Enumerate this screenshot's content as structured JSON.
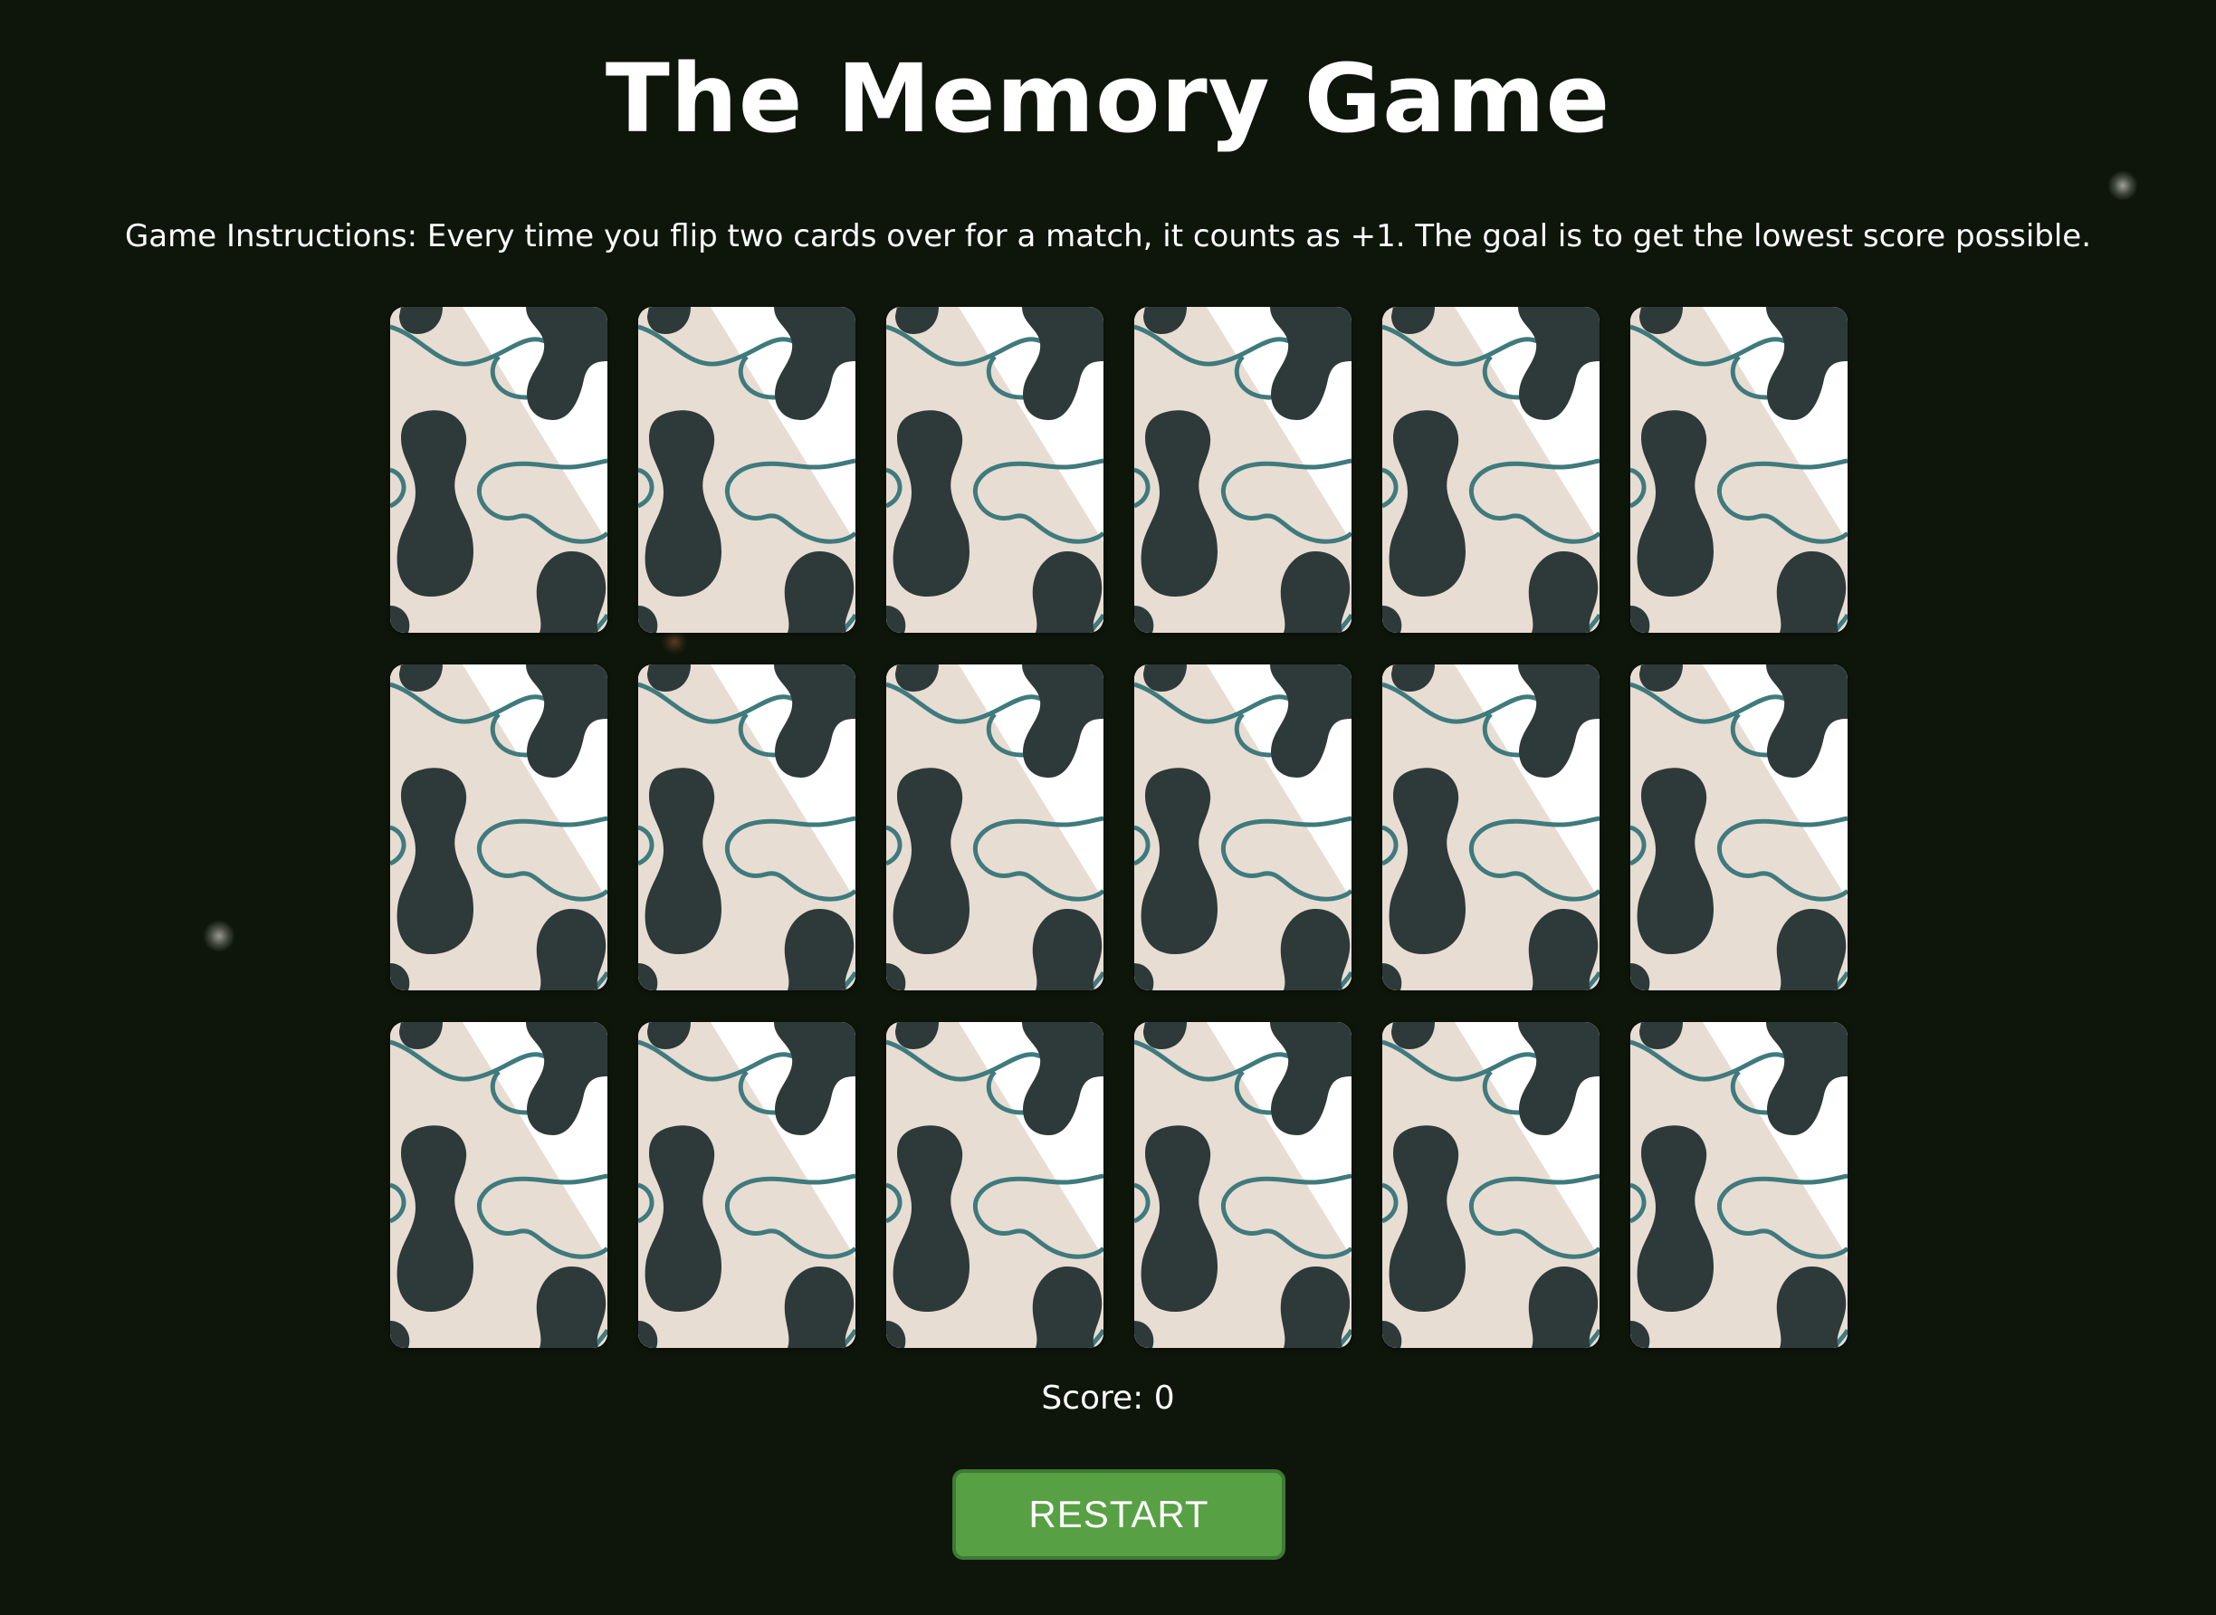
{
  "title": "The Memory Game",
  "instructions": "Game Instructions: Every time you flip two cards over for a match, it counts as +1. The goal is to get the lowest score possible.",
  "board": {
    "rows": 3,
    "columns": 6,
    "cards": [
      {
        "state": "face-down"
      },
      {
        "state": "face-down"
      },
      {
        "state": "face-down"
      },
      {
        "state": "face-down"
      },
      {
        "state": "face-down"
      },
      {
        "state": "face-down"
      },
      {
        "state": "face-down"
      },
      {
        "state": "face-down"
      },
      {
        "state": "face-down"
      },
      {
        "state": "face-down"
      },
      {
        "state": "face-down"
      },
      {
        "state": "face-down"
      },
      {
        "state": "face-down"
      },
      {
        "state": "face-down"
      },
      {
        "state": "face-down"
      },
      {
        "state": "face-down"
      },
      {
        "state": "face-down"
      },
      {
        "state": "face-down"
      }
    ]
  },
  "score": {
    "label": "Score:",
    "value": 0,
    "text": "Score: 0"
  },
  "restart_label": "RESTART",
  "colors": {
    "background": "#0e160b",
    "card_dark": "#2e3a39",
    "card_light": "#ffffff",
    "card_beige": "#e8ddd3",
    "card_line": "#3f7a7d",
    "button": "#58a044",
    "button_border": "#3f7a34"
  },
  "icons": {
    "card_back": "card-back-pattern"
  }
}
